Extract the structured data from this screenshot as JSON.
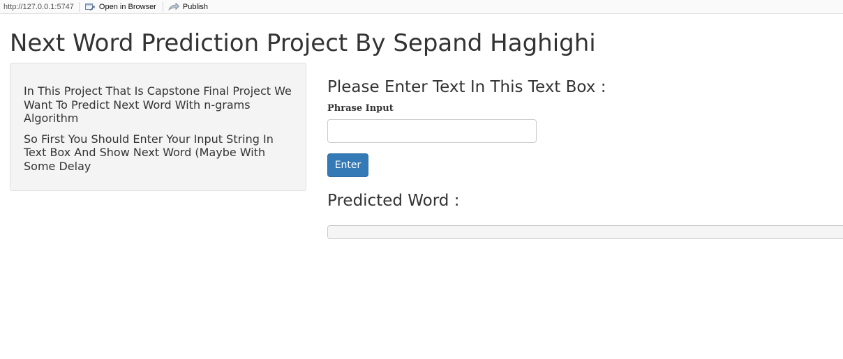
{
  "toolbar": {
    "url": "http://127.0.0.1:5747",
    "open_in_browser": "Open in Browser",
    "publish": "Publish"
  },
  "page": {
    "title": "Next Word Prediction Project By Sepand Haghighi"
  },
  "sidebar": {
    "paragraph_1": "In This Project That Is Capstone Final Project We Want To Predict Next Word With n-grams Algorithm",
    "paragraph_2": "So First You Should Enter Your Input String In Text Box And Show Next Word (Maybe With Some Delay"
  },
  "main": {
    "heading": "Please Enter Text In This Text Box :",
    "input_label": "Phrase Input",
    "input_value": "",
    "button_label": "Enter",
    "prediction_heading": "Predicted Word :",
    "prediction_value": ""
  },
  "colors": {
    "primary_button": "#337ab7",
    "sidebar_bg": "#f4f4f4"
  }
}
